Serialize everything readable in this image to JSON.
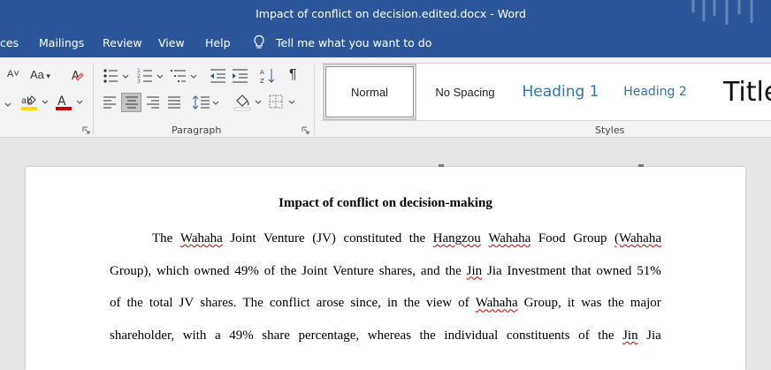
{
  "window": {
    "title": "Impact of conflict on decision.edited.docx  -  Word"
  },
  "menu": {
    "items": [
      "ces",
      "Mailings",
      "Review",
      "View",
      "Help"
    ],
    "tell_me": "Tell me what you want to do"
  },
  "ribbon": {
    "font_size_label": "Aa",
    "paragraph_label": "Paragraph",
    "styles_label": "Styles",
    "styles": [
      "Normal",
      "No Spacing",
      "Heading 1",
      "Heading 2",
      "Title"
    ],
    "colors": {
      "highlight": "#ffd800",
      "font_color": "#c00000",
      "brand": "#2b579a"
    }
  },
  "document": {
    "title": "Impact of conflict on decision-making",
    "lines": [
      [
        {
          "t": "The"
        },
        {
          "t": "Wahaha",
          "sq": true
        },
        {
          "t": "Joint"
        },
        {
          "t": "Venture"
        },
        {
          "t": "(JV)"
        },
        {
          "t": "constituted"
        },
        {
          "t": "the"
        },
        {
          "t": "Hangzou",
          "sq": true
        },
        {
          "t": "Wahaha",
          "sq": true
        },
        {
          "t": "Food"
        },
        {
          "t": "Group"
        },
        {
          "t": "(Wahaha",
          "sq": true
        }
      ],
      [
        {
          "t": "Group),"
        },
        {
          "t": "which"
        },
        {
          "t": "owned"
        },
        {
          "t": "49%"
        },
        {
          "t": "of"
        },
        {
          "t": "the"
        },
        {
          "t": "Joint"
        },
        {
          "t": "Venture"
        },
        {
          "t": "shares,"
        },
        {
          "t": "and"
        },
        {
          "t": "the"
        },
        {
          "t": "Jin",
          "sq": true
        },
        {
          "t": "Jia"
        },
        {
          "t": "Investment"
        },
        {
          "t": "that"
        },
        {
          "t": "owned"
        },
        {
          "t": "51%"
        }
      ],
      [
        {
          "t": "of"
        },
        {
          "t": "the"
        },
        {
          "t": "total"
        },
        {
          "t": "JV"
        },
        {
          "t": "shares."
        },
        {
          "t": "The"
        },
        {
          "t": "conflict"
        },
        {
          "t": "arose"
        },
        {
          "t": "since,"
        },
        {
          "t": "in"
        },
        {
          "t": "the"
        },
        {
          "t": "view"
        },
        {
          "t": "of"
        },
        {
          "t": "Wahaha",
          "sq": true
        },
        {
          "t": "Group,"
        },
        {
          "t": "it"
        },
        {
          "t": "was"
        },
        {
          "t": "the"
        },
        {
          "t": "major"
        }
      ],
      [
        {
          "t": "shareholder,"
        },
        {
          "t": "with"
        },
        {
          "t": "a"
        },
        {
          "t": "49%"
        },
        {
          "t": "share"
        },
        {
          "t": "percentage,"
        },
        {
          "t": "whereas"
        },
        {
          "t": "the"
        },
        {
          "t": "individual"
        },
        {
          "t": "constituents"
        },
        {
          "t": "of"
        },
        {
          "t": "the"
        },
        {
          "t": "Jin",
          "sq": true
        },
        {
          "t": "Jia"
        }
      ]
    ]
  }
}
